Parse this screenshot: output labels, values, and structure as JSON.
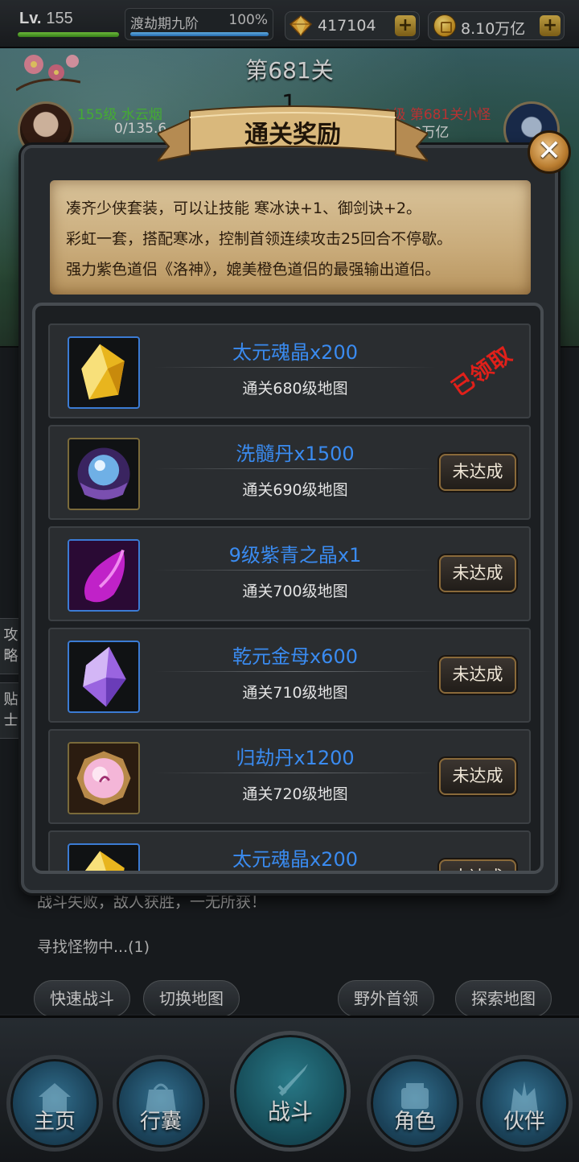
{
  "topbar": {
    "level_prefix": "Lv.",
    "level_value": "155",
    "level_progress": 1.0,
    "realm_name": "渡劫期九阶",
    "realm_pct": "100%",
    "gems": "417104",
    "gold": "8.10万亿",
    "plus_label": "+"
  },
  "battle": {
    "stage_title": "第681关",
    "round_number": "1",
    "player_name": "155级 水云烟",
    "player_hp": "0/135.6",
    "enemy_name": "680级 第681关小怪",
    "enemy_hp": "0/2.59万亿"
  },
  "modal": {
    "title": "通关奖励",
    "close_label": "✕",
    "desc_lines": [
      "凑齐少侠套装，可以让技能 寒冰诀+1、御剑诀+2。",
      "彩虹一套，搭配寒冰，控制首领连续攻击25回合不停歇。",
      "强力紫色道侣《洛神》，媲美橙色道侣的最强输出道侣。"
    ],
    "rewards": [
      {
        "name": "太元魂晶x200",
        "req": "通关680级地图",
        "status": "已领取",
        "claimed": true,
        "icon": "yellow-crystal-icon"
      },
      {
        "name": "洗髓丹x1500",
        "req": "通关690级地图",
        "status": "未达成",
        "claimed": false,
        "icon": "orb-pill-icon"
      },
      {
        "name": "9级紫青之晶x1",
        "req": "通关700级地图",
        "status": "未达成",
        "claimed": false,
        "icon": "purple-crystal-icon"
      },
      {
        "name": "乾元金母x600",
        "req": "通关710级地图",
        "status": "未达成",
        "claimed": false,
        "icon": "violet-crystal-icon"
      },
      {
        "name": "归劫丹x1200",
        "req": "通关720级地图",
        "status": "未达成",
        "claimed": false,
        "icon": "pink-gem-icon"
      },
      {
        "name": "太元魂晶x200",
        "req": "",
        "status": "未达成",
        "claimed": false,
        "icon": "yellow-crystal-icon"
      }
    ]
  },
  "side_tabs": [
    "攻略",
    "贴士"
  ],
  "log": {
    "line1": "战斗失败，敌人获胜，一无所获！",
    "line2": "寻找怪物中...(1)"
  },
  "actions": [
    "快速战斗",
    "切换地图",
    "野外首领",
    "探索地图"
  ],
  "nav": [
    "主页",
    "行囊",
    "战斗",
    "角色",
    "伙伴"
  ]
}
